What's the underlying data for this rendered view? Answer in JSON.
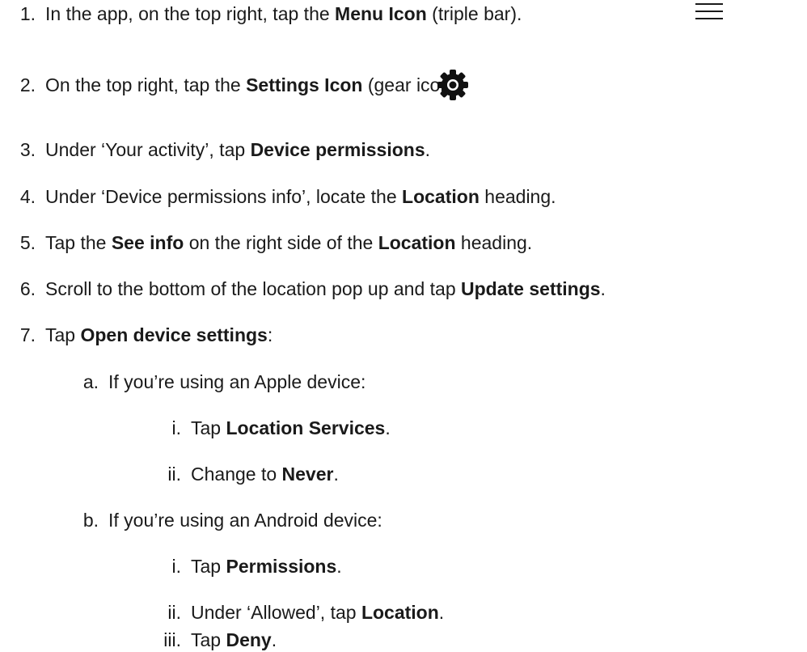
{
  "steps": [
    {
      "marker": "1.",
      "parts": [
        {
          "t": "In the app, on the top right, tap the ",
          "b": false
        },
        {
          "t": "Menu Icon",
          "b": true
        },
        {
          "t": " (triple bar).",
          "b": false
        }
      ]
    },
    {
      "marker": "2.",
      "parts": [
        {
          "t": "On the top right, tap the ",
          "b": false
        },
        {
          "t": "Settings Icon",
          "b": true
        },
        {
          "t": " (gear icon).",
          "b": false
        }
      ]
    },
    {
      "marker": "3.",
      "parts": [
        {
          "t": "Under ‘Your activity’, tap ",
          "b": false
        },
        {
          "t": "Device permissions",
          "b": true
        },
        {
          "t": ".",
          "b": false
        }
      ]
    },
    {
      "marker": "4.",
      "parts": [
        {
          "t": "Under ‘Device permissions info’, locate the ",
          "b": false
        },
        {
          "t": "Location",
          "b": true
        },
        {
          "t": " heading.",
          "b": false
        }
      ]
    },
    {
      "marker": "5.",
      "parts": [
        {
          "t": "Tap the ",
          "b": false
        },
        {
          "t": "See info",
          "b": true
        },
        {
          "t": " on the right side of the ",
          "b": false
        },
        {
          "t": "Location",
          "b": true
        },
        {
          "t": " heading.",
          "b": false
        }
      ]
    },
    {
      "marker": "6.",
      "parts": [
        {
          "t": "Scroll to the bottom of the location pop up and tap ",
          "b": false
        },
        {
          "t": "Update settings",
          "b": true
        },
        {
          "t": ".",
          "b": false
        }
      ]
    },
    {
      "marker": "7.",
      "parts": [
        {
          "t": "Tap ",
          "b": false
        },
        {
          "t": "Open device settings",
          "b": true
        },
        {
          "t": ":",
          "b": false
        }
      ]
    },
    {
      "marker": "a.",
      "parts": [
        {
          "t": "If you’re using an Apple device:",
          "b": false
        }
      ]
    },
    {
      "marker": "i.",
      "parts": [
        {
          "t": "Tap ",
          "b": false
        },
        {
          "t": "Location Services",
          "b": true
        },
        {
          "t": ".",
          "b": false
        }
      ]
    },
    {
      "marker": "ii.",
      "parts": [
        {
          "t": "Change to ",
          "b": false
        },
        {
          "t": "Never",
          "b": true
        },
        {
          "t": ".",
          "b": false
        }
      ]
    },
    {
      "marker": "b.",
      "parts": [
        {
          "t": "If you’re using an Android device:",
          "b": false
        }
      ]
    },
    {
      "marker": "i.",
      "parts": [
        {
          "t": "Tap ",
          "b": false
        },
        {
          "t": "Permissions",
          "b": true
        },
        {
          "t": ".",
          "b": false
        }
      ]
    },
    {
      "marker": "ii.",
      "parts": [
        {
          "t": "Under ‘Allowed’, tap ",
          "b": false
        },
        {
          "t": "Location",
          "b": true
        },
        {
          "t": ".",
          "b": false
        }
      ]
    },
    {
      "marker": "iii.",
      "parts": [
        {
          "t": "Tap ",
          "b": false
        },
        {
          "t": "Deny",
          "b": true
        },
        {
          "t": ".",
          "b": false
        }
      ]
    }
  ],
  "icons": {
    "menu": "menu-icon",
    "settings": "gear-icon"
  }
}
